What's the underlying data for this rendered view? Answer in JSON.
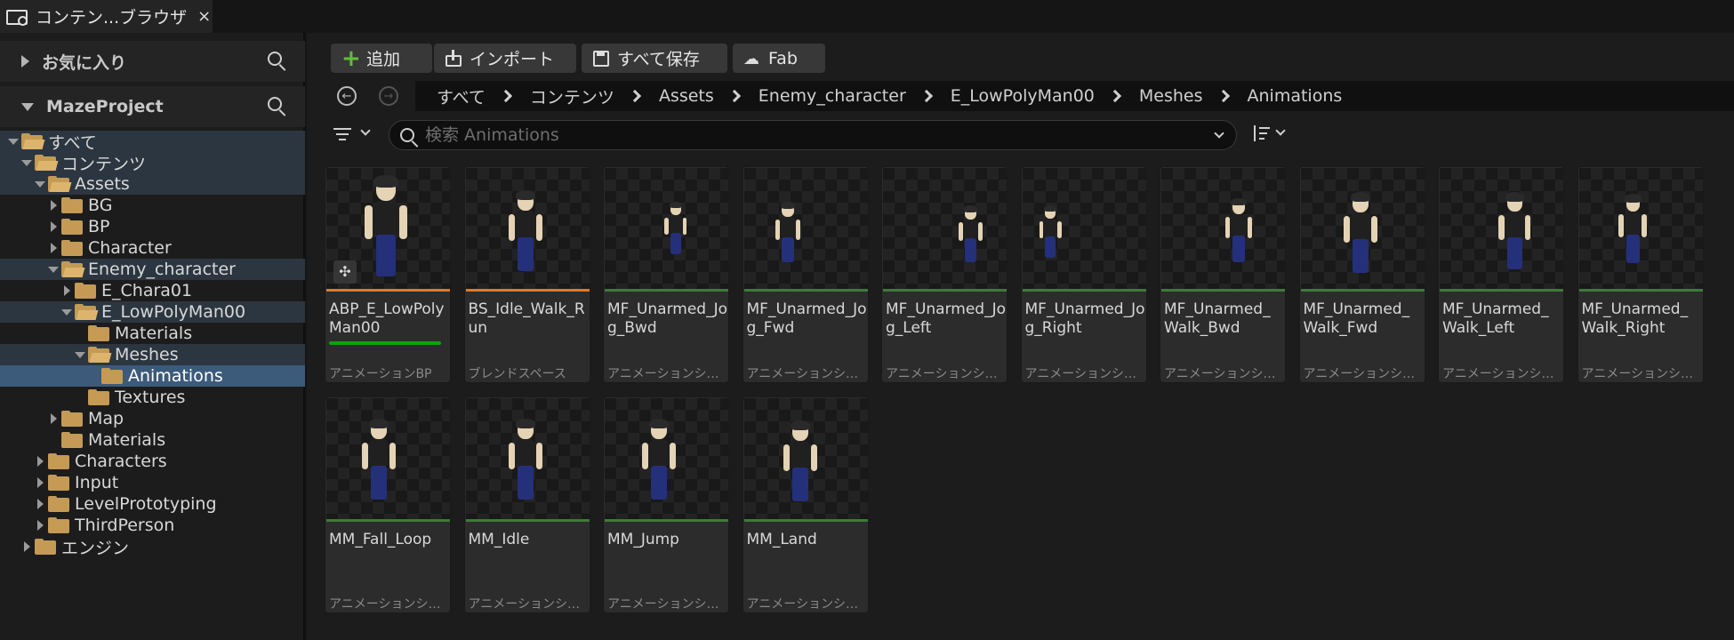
{
  "tab": {
    "title": "コンテン...ブラウザ",
    "close": "×"
  },
  "left": {
    "favorites": "お気に入り",
    "project": "MazeProject",
    "tree": [
      {
        "label": "すべて",
        "depth": 0,
        "arrow": "down",
        "open": true,
        "state": "hl"
      },
      {
        "label": "コンテンツ",
        "depth": 1,
        "arrow": "down",
        "open": true,
        "state": "hl"
      },
      {
        "label": "Assets",
        "depth": 2,
        "arrow": "down",
        "open": true,
        "state": "hl"
      },
      {
        "label": "BG",
        "depth": 3,
        "arrow": "right",
        "open": false,
        "state": ""
      },
      {
        "label": "BP",
        "depth": 3,
        "arrow": "right",
        "open": false,
        "state": ""
      },
      {
        "label": "Character",
        "depth": 3,
        "arrow": "right",
        "open": false,
        "state": ""
      },
      {
        "label": "Enemy_character",
        "depth": 3,
        "arrow": "down",
        "open": true,
        "state": "hl"
      },
      {
        "label": "E_Chara01",
        "depth": 4,
        "arrow": "right",
        "open": false,
        "state": ""
      },
      {
        "label": "E_LowPolyMan00",
        "depth": 4,
        "arrow": "down",
        "open": true,
        "state": "hl"
      },
      {
        "label": "Materials",
        "depth": 5,
        "arrow": "none",
        "open": false,
        "state": ""
      },
      {
        "label": "Meshes",
        "depth": 5,
        "arrow": "down",
        "open": true,
        "state": "hl"
      },
      {
        "label": "Animations",
        "depth": 6,
        "arrow": "none",
        "open": false,
        "state": "sel"
      },
      {
        "label": "Textures",
        "depth": 5,
        "arrow": "none",
        "open": false,
        "state": ""
      },
      {
        "label": "Map",
        "depth": 3,
        "arrow": "right",
        "open": false,
        "state": ""
      },
      {
        "label": "Materials",
        "depth": 3,
        "arrow": "none",
        "open": false,
        "state": ""
      },
      {
        "label": "Characters",
        "depth": 2,
        "arrow": "right",
        "open": false,
        "state": ""
      },
      {
        "label": "Input",
        "depth": 2,
        "arrow": "right",
        "open": false,
        "state": ""
      },
      {
        "label": "LevelPrototyping",
        "depth": 2,
        "arrow": "right",
        "open": false,
        "state": ""
      },
      {
        "label": "ThirdPerson",
        "depth": 2,
        "arrow": "right",
        "open": false,
        "state": ""
      },
      {
        "label": "エンジン",
        "depth": 1,
        "arrow": "right",
        "open": false,
        "state": ""
      }
    ]
  },
  "toolbar": {
    "add": "追加",
    "import": "インポート",
    "save_all": "すべて保存",
    "fab": "Fab"
  },
  "breadcrumb": [
    "すべて",
    "コンテンツ",
    "Assets",
    "Enemy_character",
    "E_LowPolyMan00",
    "Meshes",
    "Animations"
  ],
  "search": {
    "placeholder": "検索 Animations"
  },
  "colors": {
    "orange_stripe": "#e07a28",
    "green_stripe": "#3e7a3a",
    "selection": "#3c5a7a",
    "folder": "#c49a55"
  },
  "assets": [
    {
      "name": "ABP_E_LowPolyMan00",
      "type": "アニメーションBP",
      "stripe": "orange",
      "badge": true,
      "progress": true
    },
    {
      "name": "BS_Idle_Walk_Run",
      "type": "ブレンドスペース",
      "stripe": "orange",
      "badge": false,
      "progress": false
    },
    {
      "name": "MF_Unarmed_Jog_Bwd",
      "type": "アニメーションシーケンス",
      "stripe": "green",
      "badge": false,
      "progress": false
    },
    {
      "name": "MF_Unarmed_Jog_Fwd",
      "type": "アニメーションシーケンス",
      "stripe": "green",
      "badge": false,
      "progress": false
    },
    {
      "name": "MF_Unarmed_Jog_Left",
      "type": "アニメーションシーケンス",
      "stripe": "green",
      "badge": false,
      "progress": false
    },
    {
      "name": "MF_Unarmed_Jog_Right",
      "type": "アニメーションシーケンス",
      "stripe": "green",
      "badge": false,
      "progress": false
    },
    {
      "name": "MF_Unarmed_Walk_Bwd",
      "type": "アニメーションシーケンス",
      "stripe": "green",
      "badge": false,
      "progress": false
    },
    {
      "name": "MF_Unarmed_Walk_Fwd",
      "type": "アニメーションシーケンス",
      "stripe": "green",
      "badge": false,
      "progress": false
    },
    {
      "name": "MF_Unarmed_Walk_Left",
      "type": "アニメーションシーケンス",
      "stripe": "green",
      "badge": false,
      "progress": false
    },
    {
      "name": "MF_Unarmed_Walk_Right",
      "type": "アニメーションシーケンス",
      "stripe": "green",
      "badge": false,
      "progress": false
    },
    {
      "name": "MM_Fall_Loop",
      "type": "アニメーションシーケンス",
      "stripe": "green",
      "badge": false,
      "progress": false
    },
    {
      "name": "MM_Idle",
      "type": "アニメーションシーケンス",
      "stripe": "green",
      "badge": false,
      "progress": false
    },
    {
      "name": "MM_Jump",
      "type": "アニメーションシーケンス",
      "stripe": "green",
      "badge": false,
      "progress": false
    },
    {
      "name": "MM_Land",
      "type": "アニメーションシーケンス",
      "stripe": "green",
      "badge": false,
      "progress": false
    }
  ]
}
